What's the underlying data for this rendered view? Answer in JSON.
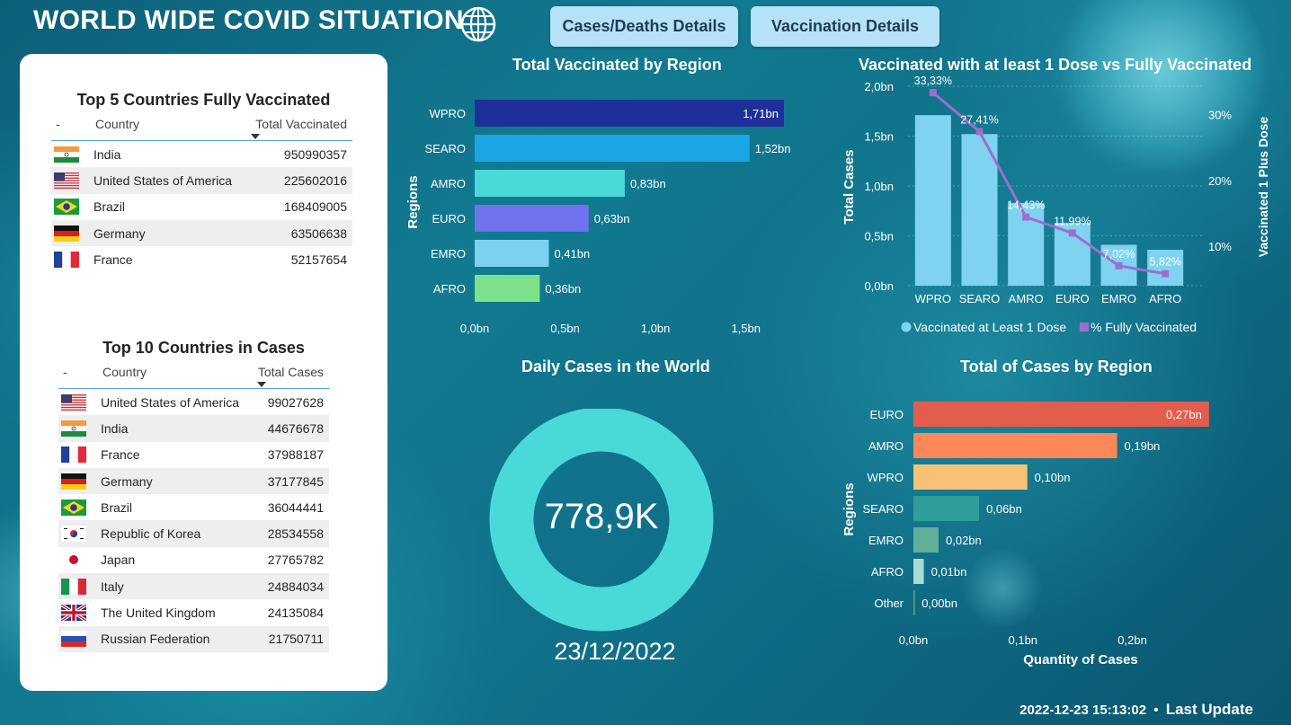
{
  "header": {
    "title": "WORLD WIDE COVID SITUATION",
    "nav": [
      "Cases/Deaths Details",
      "Vaccination Details"
    ]
  },
  "vaccinated_table": {
    "title": "Top 5 Countries Fully Vaccinated",
    "col_flag": "-",
    "col_country": "Country",
    "col_value": "Total Vaccinated",
    "rows": [
      {
        "flag": "india",
        "country": "India",
        "value": "950990357"
      },
      {
        "flag": "usa",
        "country": "United States of America",
        "value": "225602016"
      },
      {
        "flag": "brazil",
        "country": "Brazil",
        "value": "168409005"
      },
      {
        "flag": "germany",
        "country": "Germany",
        "value": "63506638"
      },
      {
        "flag": "france",
        "country": "France",
        "value": "52157654"
      }
    ]
  },
  "cases_table": {
    "title": "Top 10 Countries in Cases",
    "col_flag": "-",
    "col_country": "Country",
    "col_value": "Total Cases",
    "rows": [
      {
        "flag": "usa",
        "country": "United States of America",
        "value": "99027628"
      },
      {
        "flag": "india",
        "country": "India",
        "value": "44676678"
      },
      {
        "flag": "france",
        "country": "France",
        "value": "37988187"
      },
      {
        "flag": "germany",
        "country": "Germany",
        "value": "37177845"
      },
      {
        "flag": "brazil",
        "country": "Brazil",
        "value": "36044441"
      },
      {
        "flag": "korea",
        "country": "Republic of Korea",
        "value": "28534558"
      },
      {
        "flag": "japan",
        "country": "Japan",
        "value": "27765782"
      },
      {
        "flag": "italy",
        "country": "Italy",
        "value": "24884034"
      },
      {
        "flag": "uk",
        "country": "The United Kingdom",
        "value": "24135084"
      },
      {
        "flag": "russia",
        "country": "Russian Federation",
        "value": "21750711"
      }
    ]
  },
  "donut": {
    "title": "Daily Cases in the World",
    "value": "778,9K",
    "date": "23/12/2022",
    "color": "#4ad9d9"
  },
  "footer": {
    "timestamp": "2022-12-23 15:13:02",
    "separator": "•",
    "label": "Last Update"
  },
  "chart_data": [
    {
      "type": "bar",
      "orientation": "horizontal",
      "title": "Total Vaccinated by Region",
      "ylabel": "Regions",
      "xlabel": "",
      "categories": [
        "WPRO",
        "SEARO",
        "AMRO",
        "EURO",
        "EMRO",
        "AFRO"
      ],
      "values": [
        1.71,
        1.52,
        0.83,
        0.63,
        0.41,
        0.36
      ],
      "labels": [
        "1,71bn",
        "1,52bn",
        "0,83bn",
        "0,63bn",
        "0,41bn",
        "0,36bn"
      ],
      "colors": [
        "#1f2f99",
        "#1aa6e6",
        "#4ad9d9",
        "#7272ee",
        "#7cd1f0",
        "#7de08a"
      ],
      "xlim": [
        0,
        1.75
      ],
      "xticks": [
        0,
        0.5,
        1.0,
        1.5
      ],
      "xtick_labels": [
        "0,0bn",
        "0,5bn",
        "1,0bn",
        "1,5bn"
      ]
    },
    {
      "type": "bar+line",
      "title": "Vaccinated with at least 1 Dose vs Fully Vaccinated",
      "categories": [
        "WPRO",
        "SEARO",
        "AMRO",
        "EURO",
        "EMRO",
        "AFRO"
      ],
      "ylabel": "Total Cases",
      "y2label": "Vaccinated 1 Plus Dose",
      "series": [
        {
          "name": "Vaccinated at Least 1 Dose",
          "axis": "left",
          "values": [
            1.71,
            1.52,
            0.83,
            0.63,
            0.41,
            0.36
          ],
          "color": "#7fd3f0"
        },
        {
          "name": "% Fully Vaccinated",
          "axis": "right",
          "values": [
            33.33,
            27.41,
            14.43,
            11.99,
            7.02,
            5.82
          ],
          "labels": [
            "33,33%",
            "27,41%",
            "14,43%",
            "11,99%",
            "7,02%",
            "5,82%"
          ],
          "color": "#9b6fd0"
        }
      ],
      "ylim": [
        0,
        2.0
      ],
      "yticks": [
        0,
        0.5,
        1.0,
        1.5,
        2.0
      ],
      "ytick_labels": [
        "0,0bn",
        "0,5bn",
        "1,0bn",
        "1,5bn",
        "2,0bn"
      ],
      "y2lim": [
        4,
        34.3
      ],
      "y2ticks": [
        10,
        20,
        30
      ],
      "y2tick_labels": [
        "10%",
        "20%",
        "30%"
      ],
      "legend": "bottom"
    },
    {
      "type": "bar",
      "orientation": "horizontal",
      "title": "Total of Cases by Region",
      "ylabel": "Regions",
      "xlabel": "Quantity of Cases",
      "categories": [
        "EURO",
        "AMRO",
        "WPRO",
        "SEARO",
        "EMRO",
        "AFRO",
        "Other"
      ],
      "values": [
        0.27,
        0.186,
        0.104,
        0.06,
        0.023,
        0.0095,
        0.001
      ],
      "labels": [
        "0,27bn",
        "0,19bn",
        "0,10bn",
        "0,06bn",
        "0,02bn",
        "0,01bn",
        "0,00bn"
      ],
      "colors": [
        "#e35d4c",
        "#ff8858",
        "#f8c276",
        "#2f9f98",
        "#5faf99",
        "#a6dcd4",
        "#6f9e70"
      ],
      "xlim": [
        0,
        0.28
      ],
      "xticks": [
        0,
        0.1,
        0.2
      ],
      "xtick_labels": [
        "0,0bn",
        "0,1bn",
        "0,2bn"
      ]
    }
  ]
}
